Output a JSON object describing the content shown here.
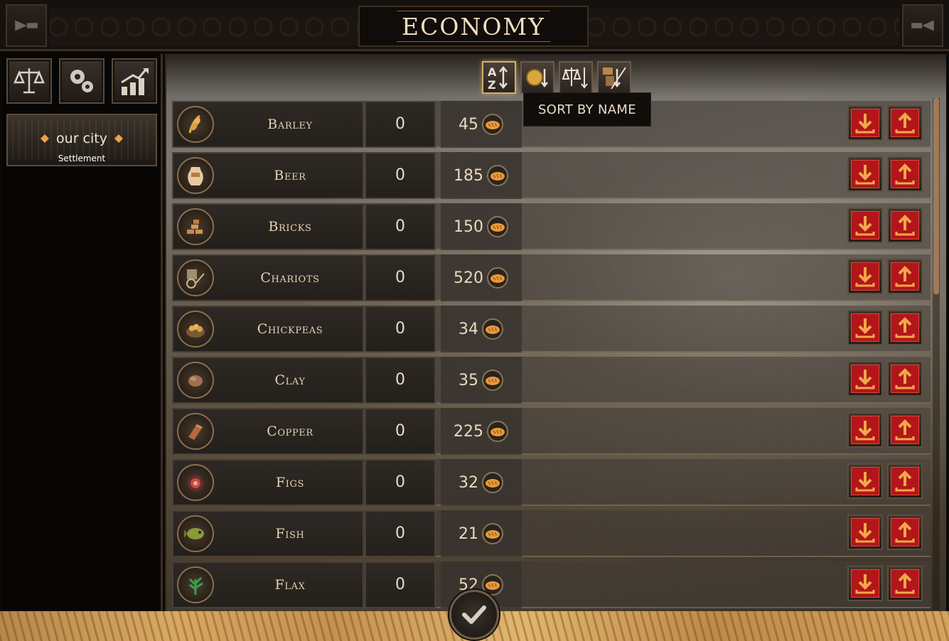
{
  "header": {
    "title": "ECONOMY",
    "left_corner_icon": "horn-icon",
    "right_corner_icon": "horn-icon"
  },
  "sidebar": {
    "buttons": [
      {
        "icon": "scales-icon"
      },
      {
        "icon": "gears-icon"
      },
      {
        "icon": "growth-chart-icon"
      }
    ],
    "city": {
      "name": "our city",
      "subtitle": "Settlement"
    }
  },
  "sort_bar": {
    "buttons": [
      {
        "icon": "sort-az-icon",
        "active": true
      },
      {
        "icon": "sort-coin-icon",
        "active": false
      },
      {
        "icon": "sort-scales-icon",
        "active": false
      },
      {
        "icon": "sort-goods-icon",
        "active": false
      }
    ],
    "tooltip": "SORT BY NAME"
  },
  "resources": [
    {
      "name": "Barley",
      "icon": "barley-icon",
      "stock": "0",
      "price": "45"
    },
    {
      "name": "Beer",
      "icon": "beer-jar-icon",
      "stock": "0",
      "price": "185"
    },
    {
      "name": "Bricks",
      "icon": "bricks-icon",
      "stock": "0",
      "price": "150"
    },
    {
      "name": "Chariots",
      "icon": "chariot-icon",
      "stock": "0",
      "price": "520"
    },
    {
      "name": "Chickpeas",
      "icon": "chickpeas-icon",
      "stock": "0",
      "price": "34"
    },
    {
      "name": "Clay",
      "icon": "clay-icon",
      "stock": "0",
      "price": "35"
    },
    {
      "name": "Copper",
      "icon": "copper-ingot-icon",
      "stock": "0",
      "price": "225"
    },
    {
      "name": "Figs",
      "icon": "fig-icon",
      "stock": "0",
      "price": "32"
    },
    {
      "name": "Fish",
      "icon": "fish-icon",
      "stock": "0",
      "price": "21"
    },
    {
      "name": "Flax",
      "icon": "flax-icon",
      "stock": "0",
      "price": "52"
    }
  ],
  "currency_icon": "bread-coin-icon",
  "actions": {
    "sell_icon": "arrow-down-icon",
    "buy_icon": "arrow-up-icon"
  },
  "colors": {
    "accent_gold": "#d3ad6a",
    "action_red": "#b3161a",
    "text_cream": "#e5d3b3"
  },
  "scroll": {
    "position_fraction": 0
  },
  "confirm_icon": "checkmark-icon"
}
